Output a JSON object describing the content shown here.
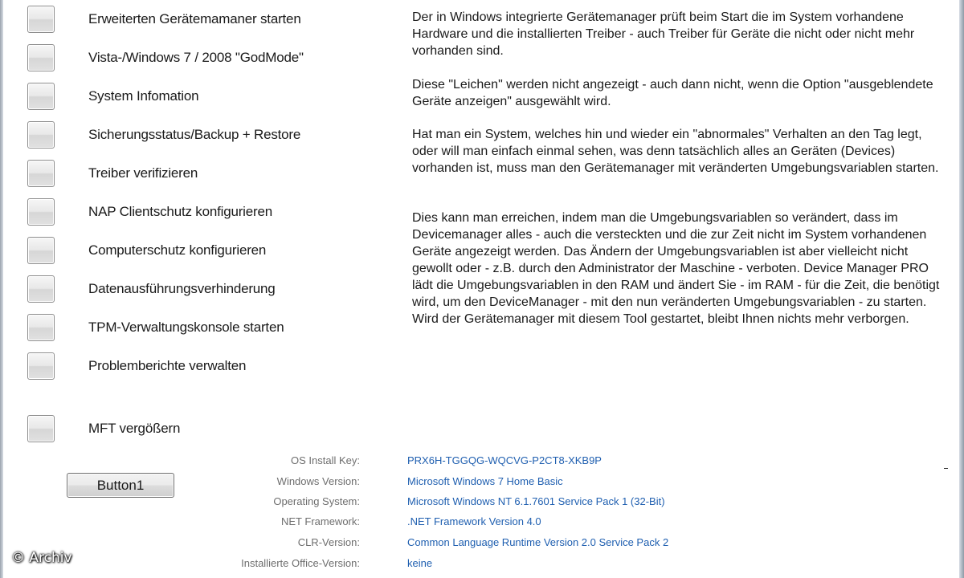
{
  "actions": [
    {
      "label": "Erweiterten Gerätemamaner starten"
    },
    {
      "label": "Vista-/Windows 7 / 2008 \"GodMode\""
    },
    {
      "label": "System Infomation"
    },
    {
      "label": "Sicherungsstatus/Backup + Restore"
    },
    {
      "label": "Treiber verifizieren"
    },
    {
      "label": "NAP Clientschutz konfigurieren"
    },
    {
      "label": "Computerschutz konfigurieren"
    },
    {
      "label": "Datenausführungsverhinderung"
    },
    {
      "label": "TPM-Verwaltungskonsole starten"
    },
    {
      "label": "Problemberichte verwalten"
    },
    {
      "label": "MFT vergößern"
    }
  ],
  "description": {
    "p1": "Der in Windows integrierte Gerätemanager prüft beim Start die im System vorhandene Hardware und die installierten Treiber -  auch Treiber für Geräte die nicht oder nicht mehr vorhanden sind.",
    "p2": "Diese \"Leichen\" werden nicht angezeigt - auch dann nicht, wenn  die Option \"ausgeblendete Geräte anzeigen\" ausgewählt wird.",
    "p3": "Hat man ein System, welches hin und wieder ein \"abnormales\" Verhalten an den Tag legt, oder will man einfach einmal sehen, was denn tatsächlich alles an Geräten (Devices) vorhanden ist, muss  man den Gerätemanager mit veränderten Umgebungsvariablen starten.",
    "p4": "Dies kann man erreichen, indem man die Umgebungsvariablen so verändert, dass im Devicemanager alles - auch die versteckten und die zur Zeit nicht im System vorhandenen Geräte angezeigt werden. Das Ändern der Umgebungsvariablen ist aber vielleicht nicht gewollt oder - z.B. durch den Administrator der Maschine - verboten. Device Manager PRO lädt die Umgebungsvariablen in den RAM und ändert Sie - im RAM - für die Zeit, die benötigt wird, um den DeviceManager - mit den nun veränderten Umgebungsvariablen - zu starten. Wird der Gerätemanager mit diesem Tool gestartet, bleibt Ihnen nichts mehr verborgen."
  },
  "button1": {
    "label": "Button1"
  },
  "system_info": [
    {
      "key": "OS Install Key:",
      "value": "PRX6H-TGGQG-WQCVG-P2CT8-XKB9P"
    },
    {
      "key": "Windows Version:",
      "value": "Microsoft Windows 7 Home Basic"
    },
    {
      "key": "Operating System:",
      "value": "Microsoft Windows NT 6.1.7601 Service Pack 1 (32-Bit)"
    },
    {
      "key": "NET Framework:",
      "value": ".NET Framework Version 4.0"
    },
    {
      "key": "CLR-Version:",
      "value": "Common Language Runtime Version 2.0 Service Pack 2"
    },
    {
      "key": "Installierte Office-Version:",
      "value": "keine"
    }
  ],
  "watermark": "© Archiv",
  "colors": {
    "background": "#ffffff",
    "link_value": "#1f5fb0",
    "key_label": "#6e6e6e"
  }
}
